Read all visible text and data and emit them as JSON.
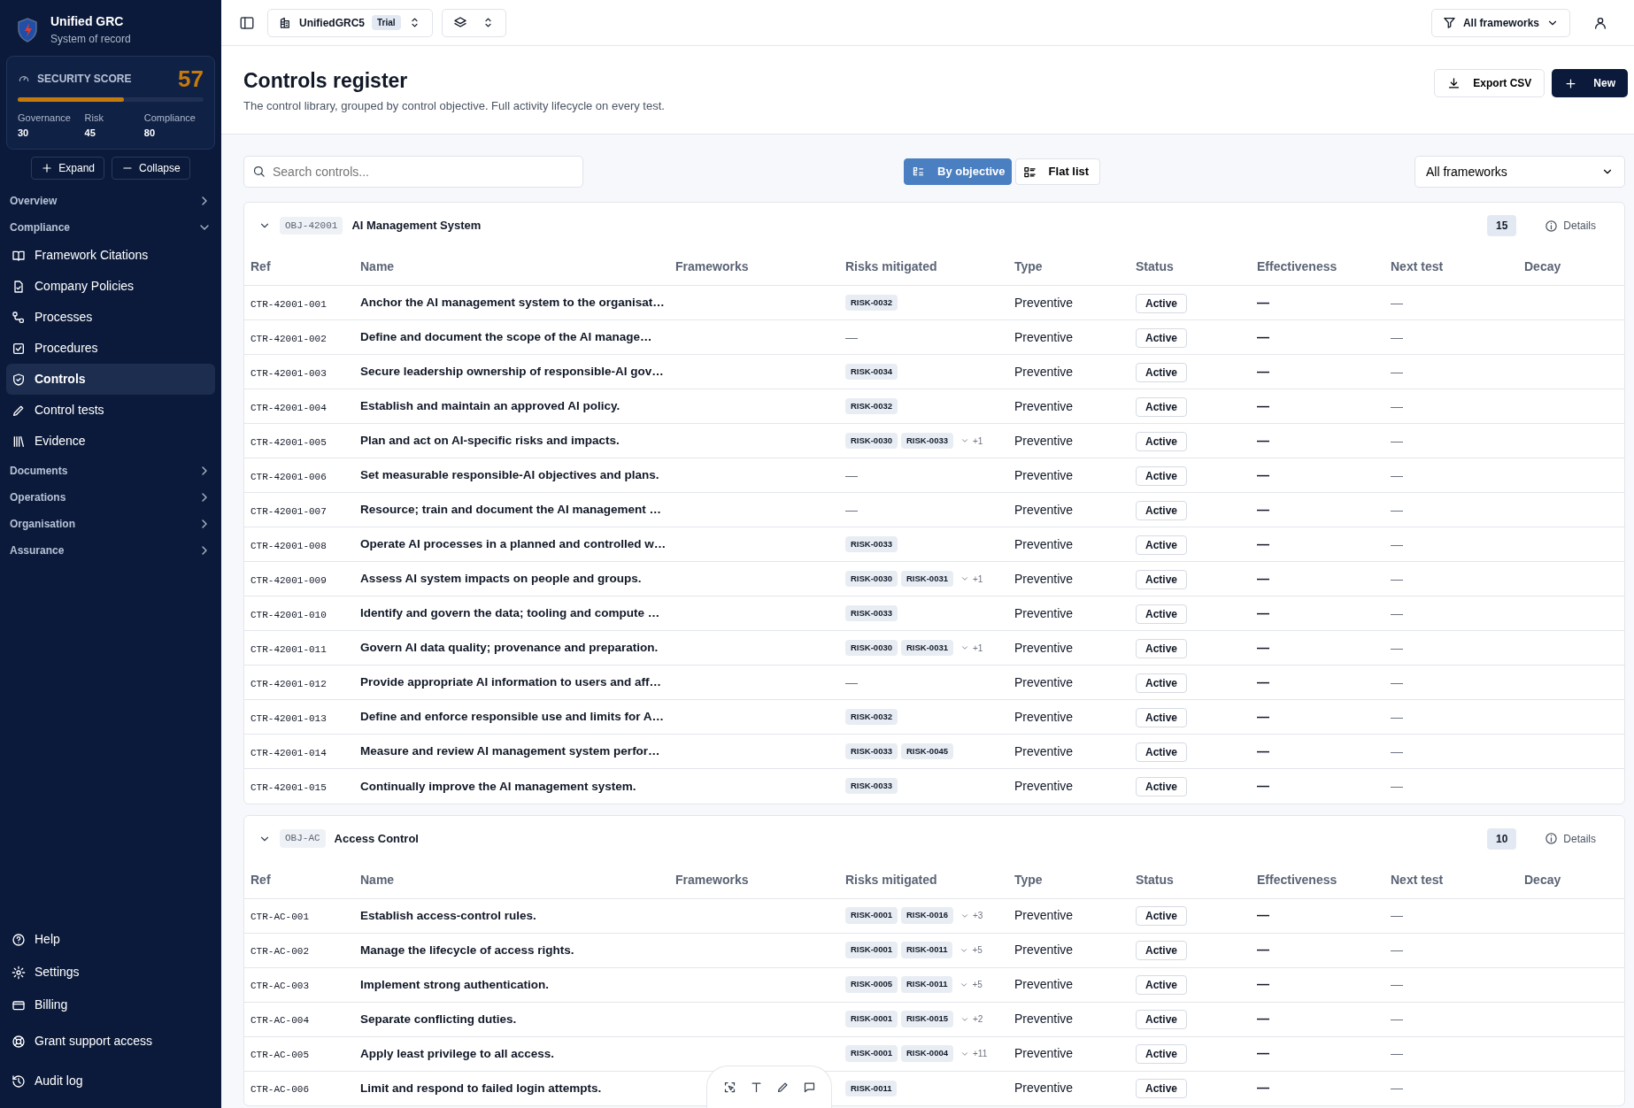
{
  "brand": {
    "title": "Unified GRC",
    "subtitle": "System of record"
  },
  "score": {
    "label": "SECURITY SCORE",
    "value": "57",
    "level": 0.57,
    "parts": [
      {
        "label": "Governance",
        "value": "30"
      },
      {
        "label": "Risk",
        "value": "45"
      },
      {
        "label": "Compliance",
        "value": "80"
      }
    ]
  },
  "tree_buttons": [
    "Expand",
    "Collapse"
  ],
  "nav": [
    {
      "label": "Overview",
      "expanded": false
    },
    {
      "label": "Compliance",
      "expanded": true,
      "children": [
        {
          "label": "Framework Citations",
          "selected": false
        },
        {
          "label": "Company Policies",
          "selected": false
        },
        {
          "label": "Processes",
          "selected": false
        },
        {
          "label": "Procedures",
          "selected": false
        },
        {
          "label": "Controls",
          "selected": true
        },
        {
          "label": "Control tests",
          "selected": false
        },
        {
          "label": "Evidence",
          "selected": false
        }
      ]
    },
    {
      "label": "Documents",
      "expanded": false
    },
    {
      "label": "Operations",
      "expanded": false
    },
    {
      "label": "Organisation",
      "expanded": false
    },
    {
      "label": "Assurance",
      "expanded": false
    }
  ],
  "footer_nav": [
    {
      "label": "Help"
    },
    {
      "label": "Settings"
    },
    {
      "label": "Billing"
    },
    {
      "label": "Grant support access"
    },
    {
      "label": "Audit log"
    }
  ],
  "topbar": {
    "workspace": "UnifiedGRC5",
    "badge": "Trial",
    "filter": "All frameworks"
  },
  "page": {
    "title": "Controls register",
    "subtitle": "The control library, grouped by control objective. Full activity lifecycle on every test.",
    "export": "Export CSV",
    "new": "New"
  },
  "toolbar": {
    "search_placeholder": "Search controls...",
    "views": [
      {
        "label": "By objective",
        "selected": true
      },
      {
        "label": "Flat list",
        "selected": false
      }
    ],
    "framework_select": "All frameworks"
  },
  "groups": [
    {
      "code": "OBJ-42001",
      "title": "AI Management System",
      "count": "15",
      "details": "Details",
      "expanded": true,
      "columns": [
        "Ref",
        "Name",
        "Frameworks",
        "Risks mitigated",
        "Type",
        "Status",
        "Effectiveness",
        "Next test",
        "Decay"
      ],
      "rows": [
        {
          "ref": "CTR-42001-001",
          "name": "Anchor the AI management system to the organisat…",
          "risks": [
            "RISK-0032"
          ],
          "type": "Preventive",
          "status": "Active",
          "effectiveness": "—",
          "next_test": "—"
        },
        {
          "ref": "CTR-42001-002",
          "name": "Define and document the scope of the AI manage…",
          "no_risks": "—",
          "type": "Preventive",
          "status": "Active",
          "effectiveness": "—",
          "next_test": "—"
        },
        {
          "ref": "CTR-42001-003",
          "name": "Secure leadership ownership of responsible-AI gov…",
          "risks": [
            "RISK-0034"
          ],
          "type": "Preventive",
          "status": "Active",
          "effectiveness": "—",
          "next_test": "—"
        },
        {
          "ref": "CTR-42001-004",
          "name": "Establish and maintain an approved AI policy.",
          "risks": [
            "RISK-0032"
          ],
          "type": "Preventive",
          "status": "Active",
          "effectiveness": "—",
          "next_test": "—"
        },
        {
          "ref": "CTR-42001-005",
          "name": "Plan and act on AI-specific risks and impacts.",
          "risks": [
            "RISK-0030",
            "RISK-0033"
          ],
          "more": "+1",
          "type": "Preventive",
          "status": "Active",
          "effectiveness": "—",
          "next_test": "—"
        },
        {
          "ref": "CTR-42001-006",
          "name": "Set measurable responsible-AI objectives and plans.",
          "no_risks": "—",
          "type": "Preventive",
          "status": "Active",
          "effectiveness": "—",
          "next_test": "—"
        },
        {
          "ref": "CTR-42001-007",
          "name": "Resource; train and document the AI management …",
          "no_risks": "—",
          "type": "Preventive",
          "status": "Active",
          "effectiveness": "—",
          "next_test": "—"
        },
        {
          "ref": "CTR-42001-008",
          "name": "Operate AI processes in a planned and controlled w…",
          "risks": [
            "RISK-0033"
          ],
          "type": "Preventive",
          "status": "Active",
          "effectiveness": "—",
          "next_test": "—"
        },
        {
          "ref": "CTR-42001-009",
          "name": "Assess AI system impacts on people and groups.",
          "risks": [
            "RISK-0030",
            "RISK-0031"
          ],
          "more": "+1",
          "type": "Preventive",
          "status": "Active",
          "effectiveness": "—",
          "next_test": "—"
        },
        {
          "ref": "CTR-42001-010",
          "name": "Identify and govern the data; tooling and compute …",
          "risks": [
            "RISK-0033"
          ],
          "type": "Preventive",
          "status": "Active",
          "effectiveness": "—",
          "next_test": "—"
        },
        {
          "ref": "CTR-42001-011",
          "name": "Govern AI data quality; provenance and preparation.",
          "risks": [
            "RISK-0030",
            "RISK-0031"
          ],
          "more": "+1",
          "type": "Preventive",
          "status": "Active",
          "effectiveness": "—",
          "next_test": "—"
        },
        {
          "ref": "CTR-42001-012",
          "name": "Provide appropriate AI information to users and aff…",
          "no_risks": "—",
          "type": "Preventive",
          "status": "Active",
          "effectiveness": "—",
          "next_test": "—"
        },
        {
          "ref": "CTR-42001-013",
          "name": "Define and enforce responsible use and limits for A…",
          "risks": [
            "RISK-0032"
          ],
          "type": "Preventive",
          "status": "Active",
          "effectiveness": "—",
          "next_test": "—"
        },
        {
          "ref": "CTR-42001-014",
          "name": "Measure and review AI management system perfor…",
          "risks": [
            "RISK-0033",
            "RISK-0045"
          ],
          "type": "Preventive",
          "status": "Active",
          "effectiveness": "—",
          "next_test": "—"
        },
        {
          "ref": "CTR-42001-015",
          "name": "Continually improve the AI management system.",
          "risks": [
            "RISK-0033"
          ],
          "type": "Preventive",
          "status": "Active",
          "effectiveness": "—",
          "next_test": "—"
        }
      ]
    },
    {
      "code": "OBJ-AC",
      "title": "Access Control",
      "count": "10",
      "details": "Details",
      "expanded": true,
      "columns": [
        "Ref",
        "Name",
        "Frameworks",
        "Risks mitigated",
        "Type",
        "Status",
        "Effectiveness",
        "Next test",
        "Decay"
      ],
      "rows": [
        {
          "ref": "CTR-AC-001",
          "name": "Establish access-control rules.",
          "risks": [
            "RISK-0001",
            "RISK-0016"
          ],
          "more": "+3",
          "type": "Preventive",
          "status": "Active",
          "effectiveness": "—",
          "next_test": "—"
        },
        {
          "ref": "CTR-AC-002",
          "name": "Manage the lifecycle of access rights.",
          "risks": [
            "RISK-0001",
            "RISK-0011"
          ],
          "more": "+5",
          "type": "Preventive",
          "status": "Active",
          "effectiveness": "—",
          "next_test": "—"
        },
        {
          "ref": "CTR-AC-003",
          "name": "Implement strong authentication.",
          "risks": [
            "RISK-0005",
            "RISK-0011"
          ],
          "more": "+5",
          "type": "Preventive",
          "status": "Active",
          "effectiveness": "—",
          "next_test": "—"
        },
        {
          "ref": "CTR-AC-004",
          "name": "Separate conflicting duties.",
          "risks": [
            "RISK-0001",
            "RISK-0015"
          ],
          "more": "+2",
          "type": "Preventive",
          "status": "Active",
          "effectiveness": "—",
          "next_test": "—"
        },
        {
          "ref": "CTR-AC-005",
          "name": "Apply least privilege to all access.",
          "risks": [
            "RISK-0001",
            "RISK-0004"
          ],
          "more": "+11",
          "type": "Preventive",
          "status": "Active",
          "effectiveness": "—",
          "next_test": "—"
        },
        {
          "ref": "CTR-AC-006",
          "name": "Limit and respond to failed login attempts.",
          "risks": [
            "RISK-0011"
          ],
          "type": "Preventive",
          "status": "Active",
          "effectiveness": "—",
          "next_test": "—"
        }
      ]
    }
  ]
}
